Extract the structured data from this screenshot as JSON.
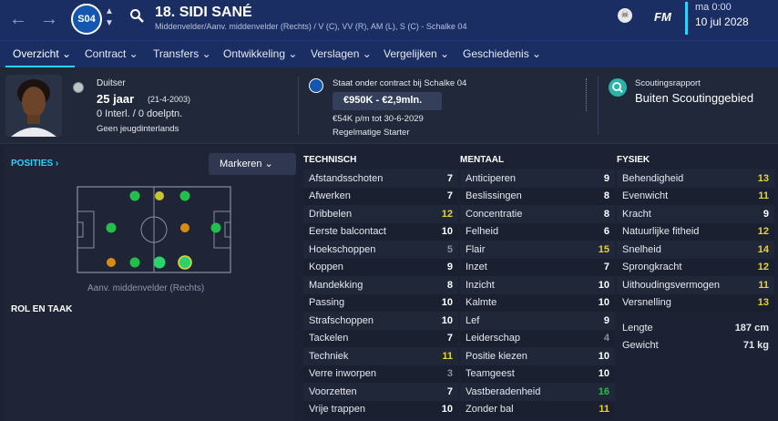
{
  "header": {
    "club_badge_text": "S04",
    "player_title": "18. SIDI SANÉ",
    "player_subtitle": "Middenvelder/Aanv. middenvelder (Rechts) / V (C), VV (R), AM (L), S (C) - Schalke 04",
    "brand": "FM",
    "time": "ma 0:00",
    "date": "10 jul 2028"
  },
  "tabs": [
    {
      "label": "Overzicht ⌄"
    },
    {
      "label": "Contract ⌄"
    },
    {
      "label": "Transfers ⌄"
    },
    {
      "label": "Ontwikkeling ⌄"
    },
    {
      "label": "Verslagen ⌄"
    },
    {
      "label": "Vergelijken ⌄"
    },
    {
      "label": "Geschiedenis ⌄"
    }
  ],
  "info": {
    "nationality": "Duitser",
    "age": "25 jaar",
    "dob": "(21-4-2003)",
    "caps": "0 Interl. / 0 doelptn.",
    "youth_caps": "Geen jeugdinterlands",
    "contract_text": "Staat onder contract bij Schalke 04",
    "value_range": "€950K - €2,9mln.",
    "wage": "€54K p/m tot 30-6-2029",
    "squad_status": "Regelmatige Starter",
    "scout_title": "Scoutingsrapport",
    "scout_value": "Buiten Scoutinggebied"
  },
  "left": {
    "posities_label": "POSITIES ›",
    "markeren_label": "Markeren ⌄",
    "pitch_label": "Aanv. middenvelder (Rechts)",
    "rol_label": "ROL EN TAAK"
  },
  "colors": {
    "green": "#22c04a",
    "yellow": "#e8d23a",
    "orange": "#d78d14",
    "gray": "#8a8fa0",
    "white": "#ffffff"
  },
  "technisch": {
    "title": "TECHNISCH",
    "rows": [
      {
        "name": "Afstandsschoten",
        "value": "7",
        "tier": "white"
      },
      {
        "name": "Afwerken",
        "value": "7",
        "tier": "white"
      },
      {
        "name": "Dribbelen",
        "value": "12",
        "tier": "yellow"
      },
      {
        "name": "Eerste balcontact",
        "value": "10",
        "tier": "white"
      },
      {
        "name": "Hoekschoppen",
        "value": "5",
        "tier": "gray"
      },
      {
        "name": "Koppen",
        "value": "9",
        "tier": "white"
      },
      {
        "name": "Mandekking",
        "value": "8",
        "tier": "white"
      },
      {
        "name": "Passing",
        "value": "10",
        "tier": "white"
      },
      {
        "name": "Strafschoppen",
        "value": "10",
        "tier": "white"
      },
      {
        "name": "Tackelen",
        "value": "7",
        "tier": "white"
      },
      {
        "name": "Techniek",
        "value": "11",
        "tier": "yellow"
      },
      {
        "name": "Verre inworpen",
        "value": "3",
        "tier": "gray"
      },
      {
        "name": "Voorzetten",
        "value": "7",
        "tier": "white"
      },
      {
        "name": "Vrije trappen",
        "value": "10",
        "tier": "white"
      }
    ]
  },
  "mentaal": {
    "title": "MENTAAL",
    "rows": [
      {
        "name": "Anticiperen",
        "value": "9",
        "tier": "white"
      },
      {
        "name": "Beslissingen",
        "value": "8",
        "tier": "white"
      },
      {
        "name": "Concentratie",
        "value": "8",
        "tier": "white"
      },
      {
        "name": "Felheid",
        "value": "6",
        "tier": "white"
      },
      {
        "name": "Flair",
        "value": "15",
        "tier": "yellow"
      },
      {
        "name": "Inzet",
        "value": "7",
        "tier": "white"
      },
      {
        "name": "Inzicht",
        "value": "10",
        "tier": "white"
      },
      {
        "name": "Kalmte",
        "value": "10",
        "tier": "white"
      },
      {
        "name": "Lef",
        "value": "9",
        "tier": "white"
      },
      {
        "name": "Leiderschap",
        "value": "4",
        "tier": "gray"
      },
      {
        "name": "Positie kiezen",
        "value": "10",
        "tier": "white"
      },
      {
        "name": "Teamgeest",
        "value": "10",
        "tier": "white"
      },
      {
        "name": "Vastberadenheid",
        "value": "16",
        "tier": "green"
      },
      {
        "name": "Zonder bal",
        "value": "11",
        "tier": "yellow"
      }
    ]
  },
  "fysiek": {
    "title": "FYSIEK",
    "rows": [
      {
        "name": "Behendigheid",
        "value": "13",
        "tier": "yellow"
      },
      {
        "name": "Evenwicht",
        "value": "11",
        "tier": "yellow"
      },
      {
        "name": "Kracht",
        "value": "9",
        "tier": "white"
      },
      {
        "name": "Natuurlijke fitheid",
        "value": "12",
        "tier": "yellow"
      },
      {
        "name": "Snelheid",
        "value": "14",
        "tier": "yellow"
      },
      {
        "name": "Sprongkracht",
        "value": "12",
        "tier": "yellow"
      },
      {
        "name": "Uithoudingsvermogen",
        "value": "11",
        "tier": "yellow"
      },
      {
        "name": "Versnelling",
        "value": "13",
        "tier": "yellow"
      }
    ],
    "bio": [
      {
        "name": "Lengte",
        "value": "187 cm"
      },
      {
        "name": "Gewicht",
        "value": "71 kg"
      }
    ]
  }
}
